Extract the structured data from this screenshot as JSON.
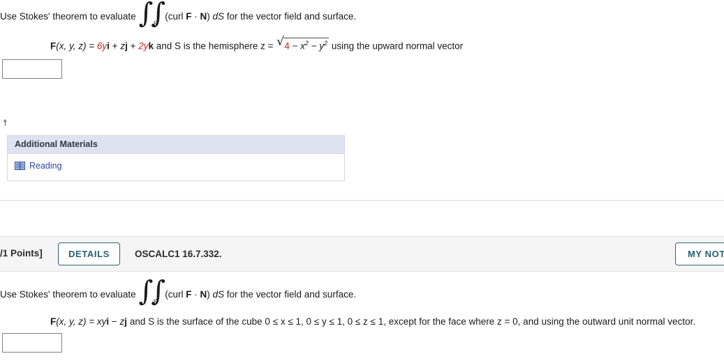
{
  "question1": {
    "prompt": {
      "before_integral": "Use Stokes' theorem to evaluate",
      "integral_subscript": "S",
      "after_integral_1": "(curl ",
      "vector_F": "F",
      "dot": " · ",
      "vector_N": "N",
      "after_integral_2": ") ",
      "dS": "dS",
      "after_integral_3": " for the vector field and surface."
    },
    "formula": {
      "field_label": "F",
      "field_args": "(x, y, z) = ",
      "i_coeff": "6y",
      "i_unit": "i",
      "plus1": " + ",
      "j_coeff": "z",
      "j_unit": "j",
      "plus2": " + ",
      "k_coeff": "2y",
      "k_unit": "k",
      "middle": " and S is the hemisphere z = ",
      "radical_glyph": "√",
      "radicand_number": "4",
      "radicand_rest_1": " − x",
      "radicand_exp_1": "2",
      "radicand_rest_2": " − y",
      "radicand_exp_2": "2",
      "tail": "using the upward normal vector"
    },
    "answer_value": "",
    "answer_placeholder": "",
    "footnote_marker": "†",
    "additional_materials": {
      "header": "Additional Materials",
      "items": [
        {
          "icon": "book-icon",
          "label": "Reading"
        }
      ]
    }
  },
  "question2": {
    "header": {
      "points_label": "/1 Points]",
      "details_label": "DETAILS",
      "question_code": "OSCALC1 16.7.332.",
      "my_notes_label": "MY NOT"
    },
    "prompt": {
      "before_integral": "Use Stokes' theorem to evaluate",
      "integral_subscript": "S",
      "after_integral_1": "(curl ",
      "vector_F": "F",
      "dot": " · ",
      "vector_N": "N",
      "after_integral_2": ") ",
      "dS": "dS",
      "after_integral_3": " for the vector field and surface."
    },
    "formula": {
      "field_label": "F",
      "field_args": "(x, y, z) = ",
      "i_coeff": "xy",
      "i_unit": "i",
      "minus": " − ",
      "j_coeff": "z",
      "j_unit": "j",
      "tail": " and S is the surface of the cube 0 ≤ x ≤ 1, 0 ≤ y ≤ 1, 0 ≤ z ≤ 1, except for the face where z = 0, and using the outward unit normal vector."
    },
    "answer_value": "",
    "answer_placeholder": ""
  },
  "colors": {
    "accent_red": "#cc2222",
    "button_teal": "#2a6070",
    "panel_header_blue": "#dde3f1",
    "link_blue": "#2b4a9b",
    "band_gray": "#f5f5f5"
  }
}
